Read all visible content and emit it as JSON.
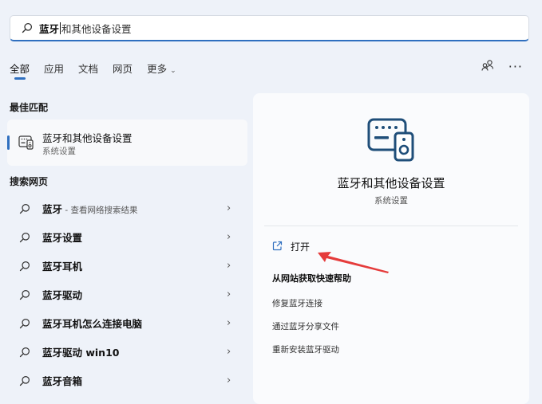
{
  "search": {
    "typed": "蓝牙",
    "suggestion": "和其他设备设置"
  },
  "tabs": [
    {
      "label": "全部",
      "active": true
    },
    {
      "label": "应用",
      "active": false
    },
    {
      "label": "文档",
      "active": false
    },
    {
      "label": "网页",
      "active": false
    },
    {
      "label": "更多",
      "active": false,
      "has_dropdown": true
    }
  ],
  "more_menu": "···",
  "best_match": {
    "heading": "最佳匹配",
    "title": "蓝牙和其他设备设置",
    "subtitle": "系统设置"
  },
  "web": {
    "heading": "搜索网页",
    "items": [
      {
        "label": "蓝牙",
        "suffix": " - 查看网络搜索结果"
      },
      {
        "label": "蓝牙设置",
        "suffix": ""
      },
      {
        "label": "蓝牙耳机",
        "suffix": ""
      },
      {
        "label": "蓝牙驱动",
        "suffix": ""
      },
      {
        "label": "蓝牙耳机怎么连接电脑",
        "suffix": ""
      },
      {
        "label": "蓝牙驱动 win10",
        "suffix": ""
      },
      {
        "label": "蓝牙音箱",
        "suffix": ""
      }
    ]
  },
  "detail": {
    "title": "蓝牙和其他设备设置",
    "subtitle": "系统设置",
    "open_label": "打开",
    "help_heading": "从网站获取快速帮助",
    "links": [
      "修复蓝牙连接",
      "通过蓝牙分享文件",
      "重新安装蓝牙驱动"
    ]
  },
  "colors": {
    "accent": "#2f6fbf",
    "arrow": "#e53b3b",
    "background": "#eef2f9"
  }
}
